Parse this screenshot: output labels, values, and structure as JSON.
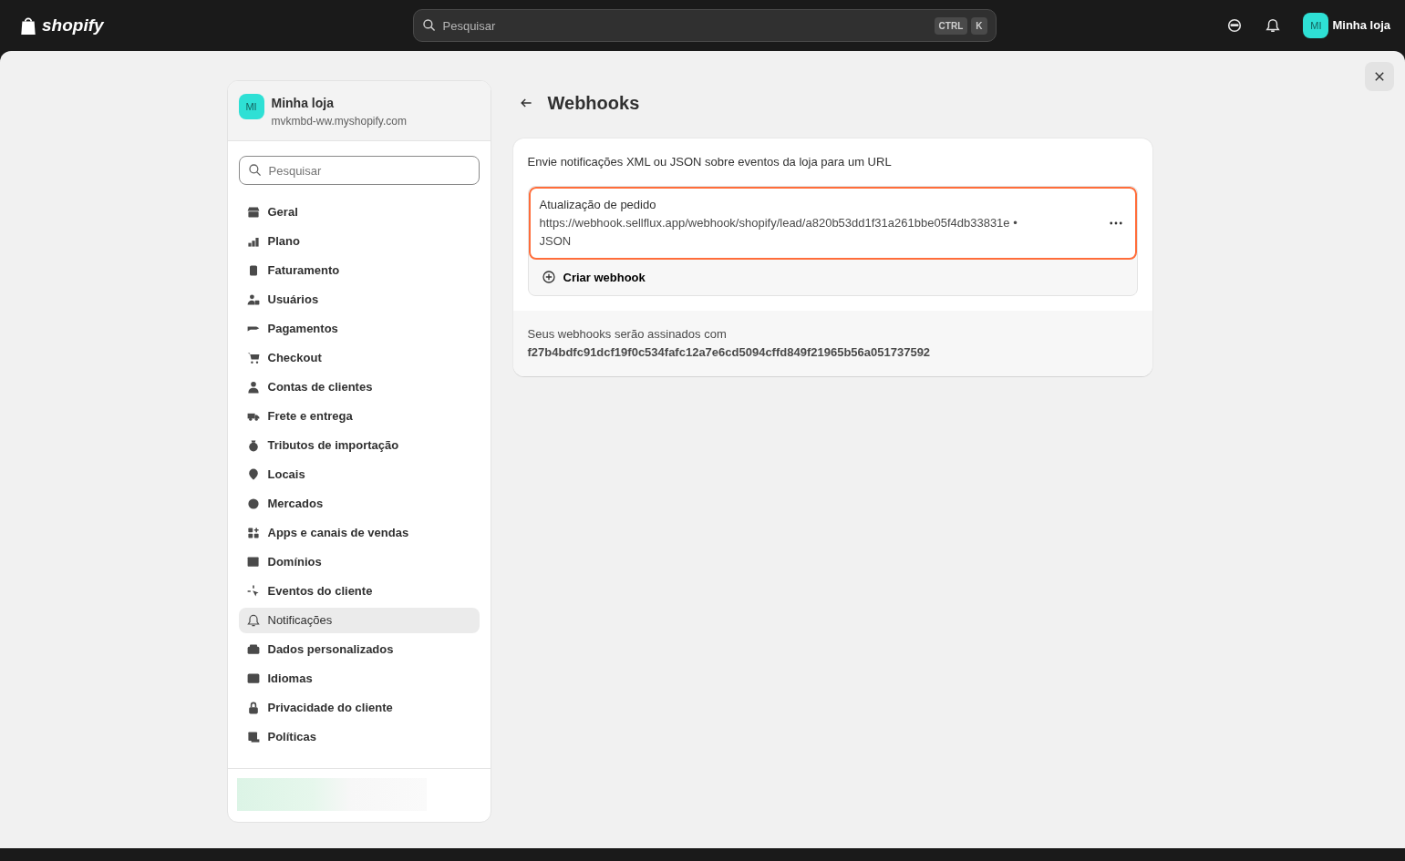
{
  "topbar": {
    "logo": "shopify",
    "search": {
      "placeholder": "Pesquisar"
    },
    "shortcut": [
      "CTRL",
      "K"
    ],
    "store_initials": "MI",
    "store_name": "Minha loja"
  },
  "sidebar": {
    "store": {
      "initials": "MI",
      "name": "Minha loja",
      "domain": "mvkmbd-ww.myshopify.com"
    },
    "search": {
      "placeholder": "Pesquisar"
    },
    "items": [
      {
        "label": "Geral",
        "selected": false
      },
      {
        "label": "Plano",
        "selected": false
      },
      {
        "label": "Faturamento",
        "selected": false
      },
      {
        "label": "Usuários",
        "selected": false
      },
      {
        "label": "Pagamentos",
        "selected": false
      },
      {
        "label": "Checkout",
        "selected": false
      },
      {
        "label": "Contas de clientes",
        "selected": false
      },
      {
        "label": "Frete e entrega",
        "selected": false
      },
      {
        "label": "Tributos de importação",
        "selected": false
      },
      {
        "label": "Locais",
        "selected": false
      },
      {
        "label": "Mercados",
        "selected": false
      },
      {
        "label": "Apps e canais de vendas",
        "selected": false
      },
      {
        "label": "Domínios",
        "selected": false
      },
      {
        "label": "Eventos do cliente",
        "selected": false
      },
      {
        "label": "Notificações",
        "selected": true
      },
      {
        "label": "Dados personalizados",
        "selected": false
      },
      {
        "label": "Idiomas",
        "selected": false
      },
      {
        "label": "Privacidade do cliente",
        "selected": false
      },
      {
        "label": "Políticas",
        "selected": false
      }
    ]
  },
  "page": {
    "title": "Webhooks",
    "description": "Envie notificações XML ou JSON sobre eventos da loja para um URL",
    "webhooks": [
      {
        "event": "Atualização de pedido",
        "url": "https://webhook.sellflux.app/webhook/shopify/lead/a820b53dd1f31a261bbe05f4db33831e •",
        "format": "JSON",
        "selected": true
      }
    ],
    "create_button": "Criar webhook",
    "signature_label": "Seus webhooks serão assinados com",
    "signature": "f27b4bdfc91dcf19f0c534fafc12a7e6cd5094cffd849f21965b56a051737592"
  }
}
